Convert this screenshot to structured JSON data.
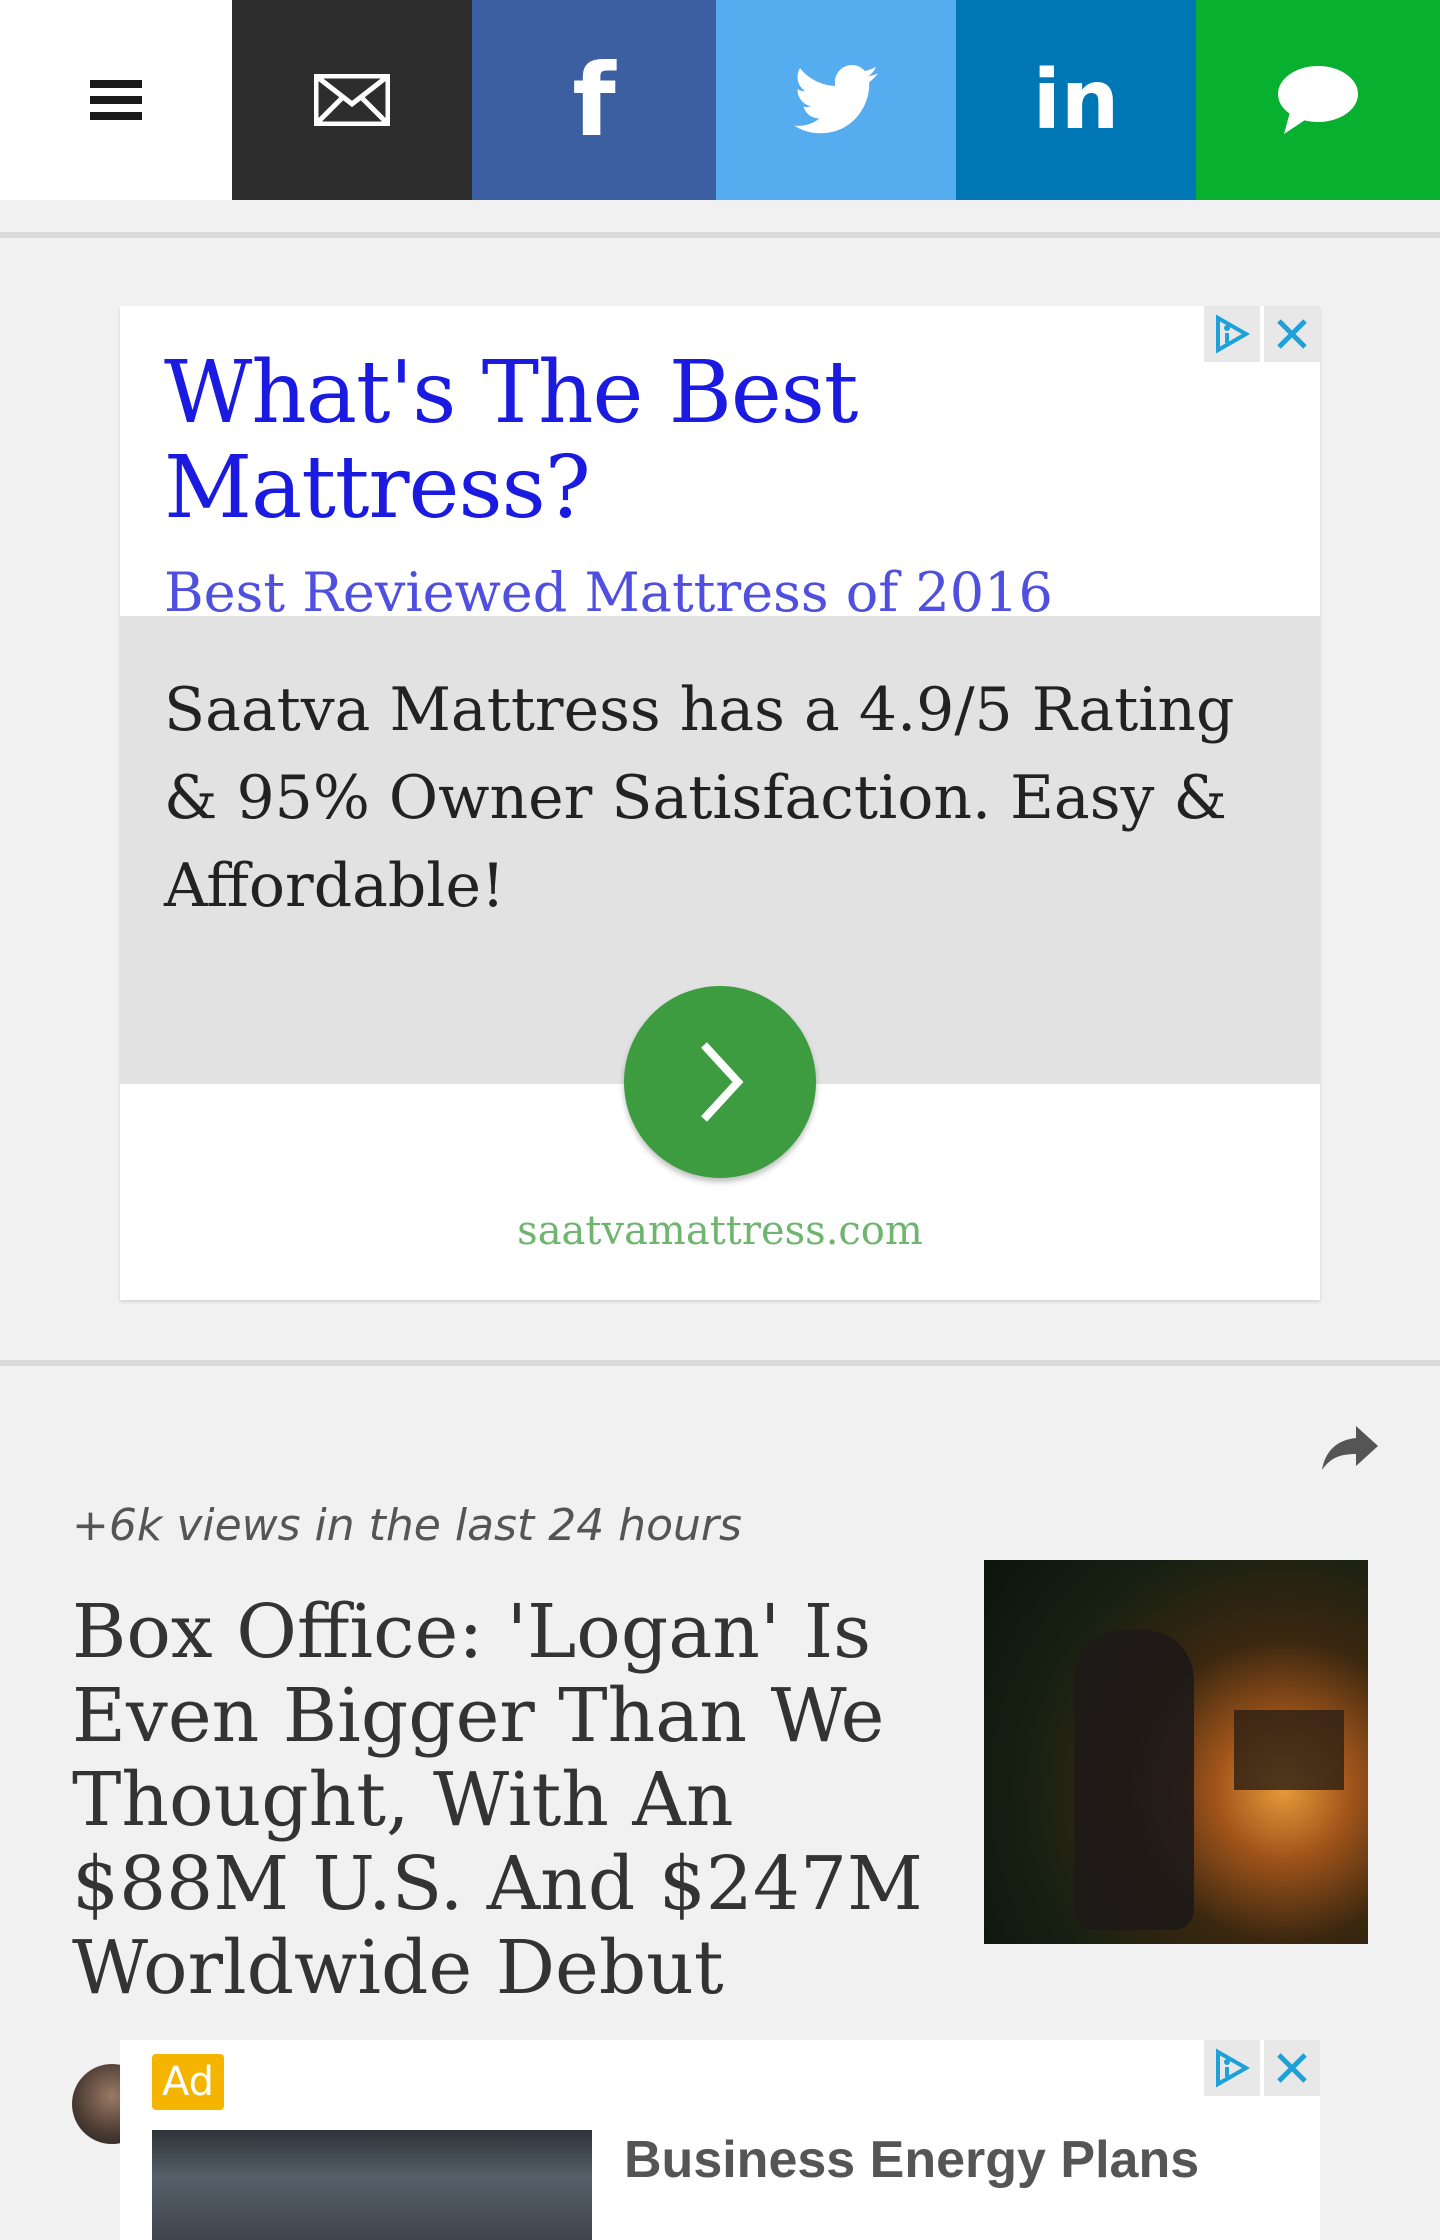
{
  "share_bar": {
    "items": [
      {
        "id": "menu",
        "icon": "hamburger-menu-icon",
        "color": "#ffffff"
      },
      {
        "id": "email",
        "icon": "envelope-icon",
        "color": "#2d2d2d"
      },
      {
        "id": "facebook",
        "icon": "facebook-icon",
        "label": "f",
        "color": "#3b5fa0"
      },
      {
        "id": "twitter",
        "icon": "twitter-bird-icon",
        "color": "#55acee"
      },
      {
        "id": "linkedin",
        "icon": "linkedin-icon",
        "label": "in",
        "color": "#0077b5"
      },
      {
        "id": "sms",
        "icon": "speech-bubble-icon",
        "color": "#07b02f"
      }
    ]
  },
  "ad_top": {
    "title": "What's The Best Mattress?",
    "subtitle": "Best Reviewed Mattress of 2016",
    "description": "Saatva Mattress has a 4.9/5 Rating & 95% Owner Satisfaction. Easy & Affordable!",
    "domain": "saatvamattress.com",
    "adchoices_icon": "adchoices-icon",
    "close_icon": "close-icon",
    "cta_icon": "chevron-right-icon"
  },
  "article": {
    "views": "+6k views in the last 24 hours",
    "headline": "Box Office: 'Logan' Is Even Bigger Than We Thought, With An $88M U.S. And $247M Worldwide Debut",
    "share_icon": "share-arrow-icon"
  },
  "ad_bottom": {
    "badge": "Ad",
    "title": "Business Energy Plans"
  }
}
